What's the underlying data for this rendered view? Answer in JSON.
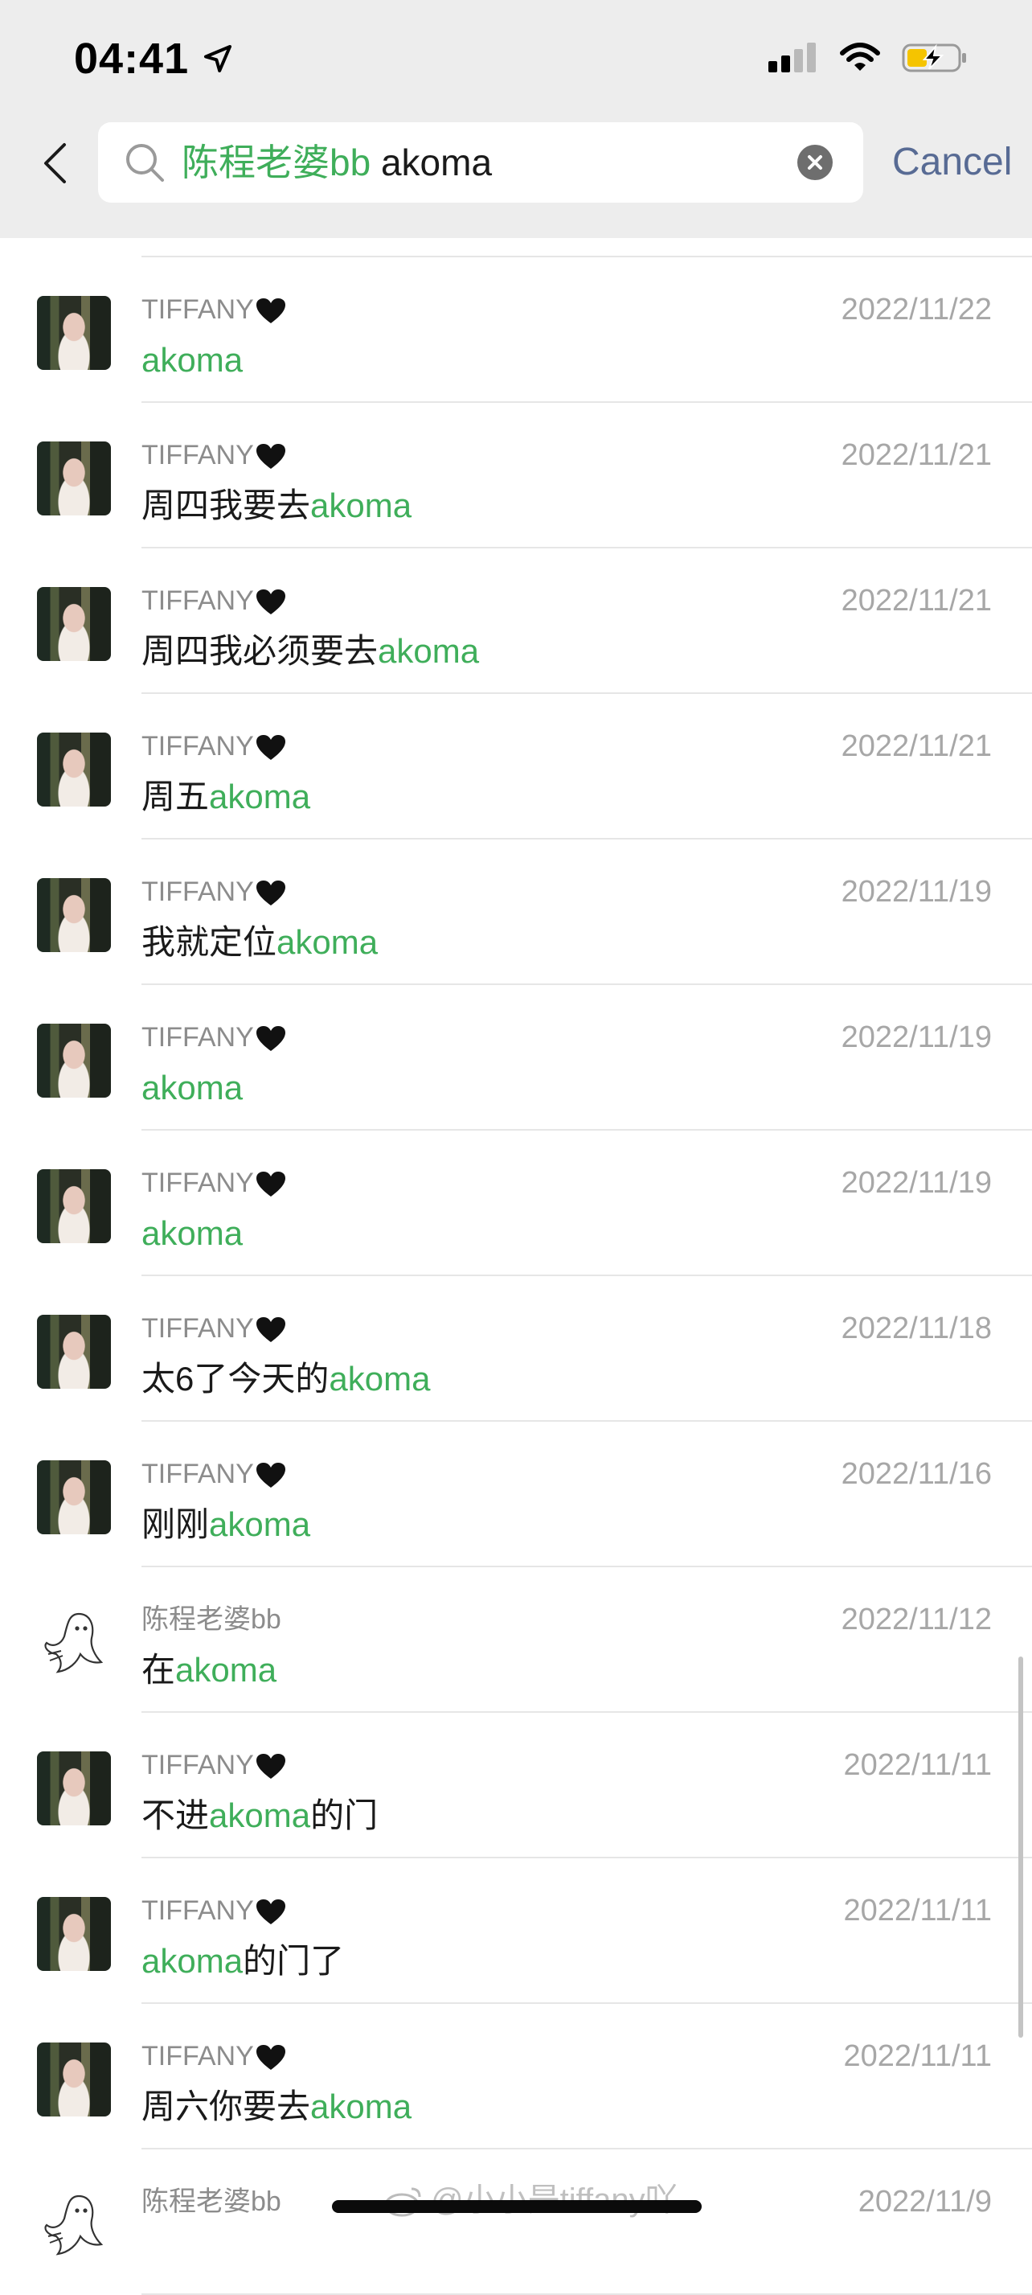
{
  "status_bar": {
    "time": "04:41",
    "icons": [
      "location-arrow-icon",
      "cellular-signal-icon",
      "wifi-icon",
      "battery-charging-icon"
    ]
  },
  "search": {
    "back_icon": "chevron-left-icon",
    "search_icon": "magnifier-icon",
    "contact_filter": "陈程老婆bb",
    "query": "akoma",
    "clear_icon": "clear-x-icon",
    "cancel_label": "Cancel"
  },
  "results": [
    {
      "avatar": "photo",
      "name": "TIFFANY",
      "heart": true,
      "date": "2022/11/22",
      "pre": "",
      "highlight": "akoma",
      "post": ""
    },
    {
      "avatar": "photo",
      "name": "TIFFANY",
      "heart": true,
      "date": "2022/11/21",
      "pre": "周四我要去",
      "highlight": "akoma",
      "post": ""
    },
    {
      "avatar": "photo",
      "name": "TIFFANY",
      "heart": true,
      "date": "2022/11/21",
      "pre": "周四我必须要去",
      "highlight": "akoma",
      "post": ""
    },
    {
      "avatar": "photo",
      "name": "TIFFANY",
      "heart": true,
      "date": "2022/11/21",
      "pre": "周五",
      "highlight": "akoma",
      "post": ""
    },
    {
      "avatar": "photo",
      "name": "TIFFANY",
      "heart": true,
      "date": "2022/11/19",
      "pre": "我就定位",
      "highlight": "akoma",
      "post": ""
    },
    {
      "avatar": "photo",
      "name": "TIFFANY",
      "heart": true,
      "date": "2022/11/19",
      "pre": "",
      "highlight": "akoma",
      "post": ""
    },
    {
      "avatar": "photo",
      "name": "TIFFANY",
      "heart": true,
      "date": "2022/11/19",
      "pre": "",
      "highlight": "akoma",
      "post": ""
    },
    {
      "avatar": "photo",
      "name": "TIFFANY",
      "heart": true,
      "date": "2022/11/18",
      "pre": "太6了今天的",
      "highlight": "akoma",
      "post": ""
    },
    {
      "avatar": "photo",
      "name": "TIFFANY",
      "heart": true,
      "date": "2022/11/16",
      "pre": "刚刚",
      "highlight": "akoma",
      "post": ""
    },
    {
      "avatar": "ghost",
      "name": "陈程老婆bb",
      "heart": false,
      "date": "2022/11/12",
      "pre": "在",
      "highlight": "akoma",
      "post": ""
    },
    {
      "avatar": "photo",
      "name": "TIFFANY",
      "heart": true,
      "date": "2022/11/11",
      "pre": "不进",
      "highlight": "akoma",
      "post": "的门"
    },
    {
      "avatar": "photo",
      "name": "TIFFANY",
      "heart": true,
      "date": "2022/11/11",
      "pre": "",
      "highlight": "akoma",
      "post": "的门了"
    },
    {
      "avatar": "photo",
      "name": "TIFFANY",
      "heart": true,
      "date": "2022/11/11",
      "pre": "周六你要去",
      "highlight": "akoma",
      "post": ""
    },
    {
      "avatar": "ghost",
      "name": "陈程老婆bb",
      "heart": false,
      "date": "2022/11/9",
      "pre": "",
      "highlight": "",
      "post": ""
    }
  ],
  "watermark": "@小小是tiffany吖",
  "colors": {
    "highlight": "#3fae5a",
    "cancel": "#586b94",
    "header_bg": "#ededed",
    "meta_text": "#8c8c8c",
    "date_text": "#a7a7a7"
  }
}
